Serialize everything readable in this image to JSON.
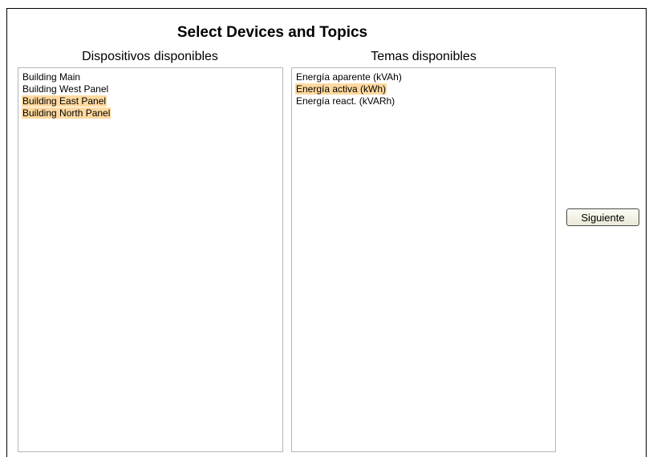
{
  "title": "Select Devices and Topics",
  "devices": {
    "heading": "Dispositivos disponibles",
    "options": [
      {
        "label": "Building Main",
        "selected": false
      },
      {
        "label": "Building West Panel",
        "selected": false
      },
      {
        "label": "Building East Panel",
        "selected": true
      },
      {
        "label": "Building North Panel",
        "selected": true
      }
    ]
  },
  "topics": {
    "heading": "Temas disponibles",
    "options": [
      {
        "label": "Energía aparente (kVAh)",
        "selected": false
      },
      {
        "label": "Energía activa (kWh)",
        "selected": true
      },
      {
        "label": "Energía react. (kVARh)",
        "selected": false
      }
    ]
  },
  "next_button_label": "Siguiente",
  "colors": {
    "selection_highlight": "#ffd9a0",
    "listbox_border": "#b5b5b5",
    "frame_border": "#000000"
  }
}
